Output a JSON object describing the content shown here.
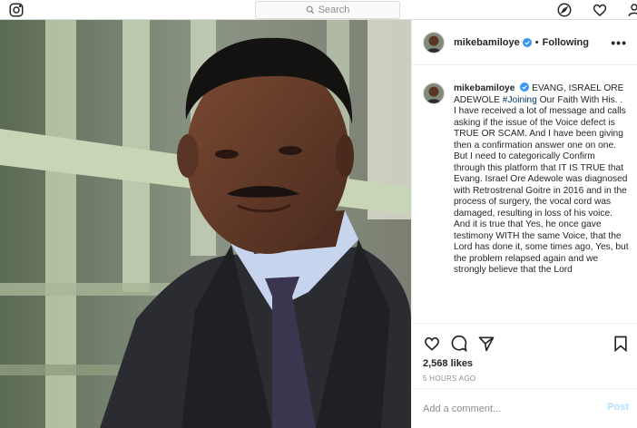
{
  "topbar": {
    "logo_icon": "instagram-icon",
    "search_placeholder": "Search",
    "nav_icons": [
      "explore-compass-icon",
      "activity-heart-icon",
      "profile-icon"
    ]
  },
  "post": {
    "username": "mikebamiloye",
    "follow_status": "Following",
    "caption": {
      "username": "mikebamiloye",
      "lead": "EVANG, ISRAEL ORE ADEWOLE ",
      "hashtag": "#Joining",
      "after_hashtag": " Our Faith With His. .",
      "paragraphs": [
        "I have received a lot of message and calls asking if the issue of the Voice defect is TRUE OR SCAM. And I have been giving then a confirmation answer one on one. But I need to categorically Confirm through this platform that IT IS TRUE that Evang. Israel Ore Adewole was diagnosed with Retrostrenal Goitre in 2016 and in the process of surgery, the vocal cord was damaged, resulting in loss of his voice.",
        "And it is true that Yes, he once gave testimony WITH the same Voice, that the Lord has done it, some times ago, Yes, but the problem relapsed again and we strongly believe that the Lord"
      ]
    },
    "likes": "2,568 likes",
    "time": "5 HOURS AGO",
    "comment_placeholder": "Add a comment...",
    "post_label": "Post",
    "colors": {
      "verified": "#3897f0",
      "hashtag": "#00376b",
      "post_disabled": "#b2dffc"
    }
  }
}
